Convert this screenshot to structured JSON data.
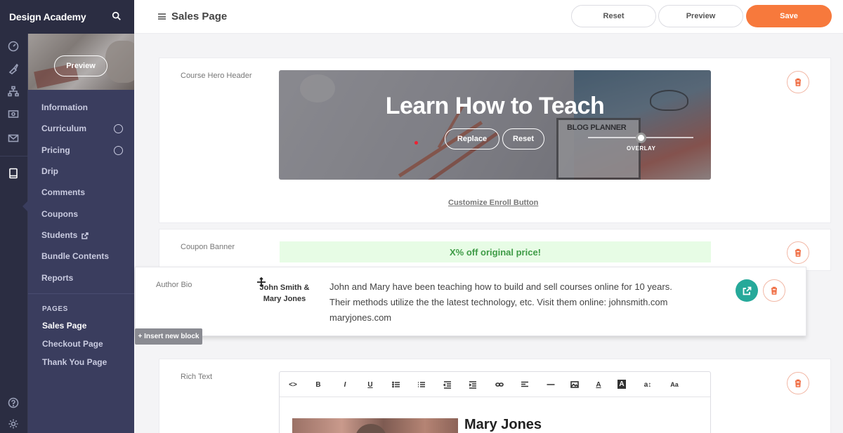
{
  "brand": {
    "title": "Design Academy",
    "search_icon": "search-icon"
  },
  "rail": {
    "icons": [
      "dashboard-icon",
      "brush-icon",
      "sitemap-icon",
      "money-icon",
      "mail-icon",
      "book-icon",
      "help-icon",
      "settings-icon"
    ],
    "active": "book-icon"
  },
  "course": {
    "preview_label": "Preview",
    "nav": [
      {
        "label": "Information"
      },
      {
        "label": "Curriculum",
        "circle": true
      },
      {
        "label": "Pricing",
        "circle": true
      },
      {
        "label": "Drip"
      },
      {
        "label": "Comments"
      },
      {
        "label": "Coupons"
      },
      {
        "label": "Students",
        "external": true
      },
      {
        "label": "Bundle Contents"
      },
      {
        "label": "Reports"
      }
    ],
    "pages_heading": "PAGES",
    "pages": [
      "Sales Page",
      "Checkout Page",
      "Thank You Page"
    ],
    "current_page": "Sales Page"
  },
  "header": {
    "title": "Sales Page",
    "reset_label": "Reset",
    "preview_label": "Preview",
    "save_label": "Save",
    "accent": "#f7793c"
  },
  "blocks": {
    "hero": {
      "label": "Course Hero Header",
      "title": "Learn How to Teach",
      "replace_label": "Replace",
      "reset_label": "Reset",
      "overlay_label": "OVERLAY",
      "planner_label": "BLOG PLANNER",
      "enroll_link": "Customize Enroll Button"
    },
    "coupon": {
      "label": "Coupon Banner",
      "text": "X% off original price!"
    },
    "author": {
      "label": "Author Bio",
      "name1": "John Smith &",
      "name2": "Mary Jones",
      "bio": "John and Mary have been teaching how to build and sell courses online for 10 years. Their methods utilize the the latest technology, etc. Visit them online: johnsmith.com maryjones.com",
      "insert_tip": "+ Insert new block"
    },
    "richtext": {
      "label": "Rich Text",
      "toolbar": [
        "<>",
        "B",
        "I",
        "U",
        "ul",
        "ol",
        "outdent",
        "indent",
        "link",
        "align",
        "hr",
        "image",
        "A",
        "A-bg",
        "a↕",
        "Aa"
      ],
      "heading": "Mary Jones"
    }
  }
}
